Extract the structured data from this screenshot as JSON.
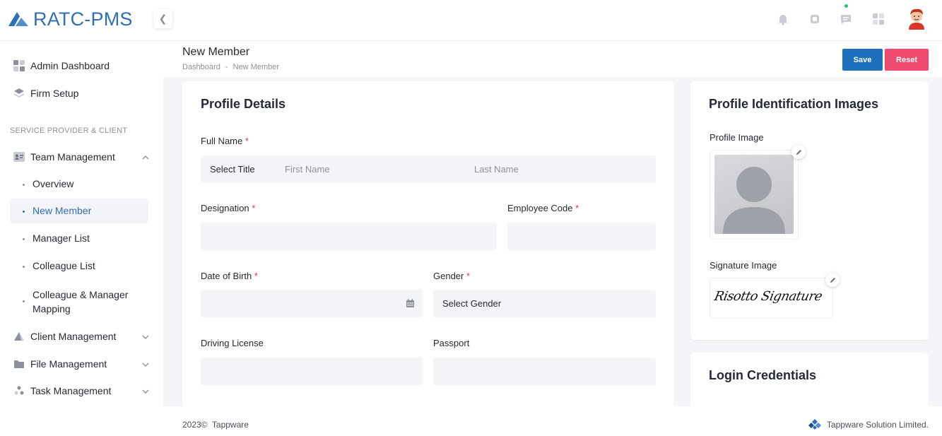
{
  "app": {
    "title": "RATC-PMS"
  },
  "colors": {
    "brand": "#2f6fb6",
    "save": "#1f6fbf",
    "reset": "#ef4a6f",
    "required": "#e5364f",
    "online": "#27c46b"
  },
  "header": {
    "collapse_icon": "chevron-left-icon",
    "icons": [
      "bell-icon",
      "square-icon",
      "chat-icon",
      "apps-grid-icon"
    ],
    "avatar": "user-avatar"
  },
  "sidebar": {
    "items": [
      {
        "label": "Admin Dashboard",
        "icon": "dashboard-grid-icon"
      },
      {
        "label": "Firm Setup",
        "icon": "layers-icon"
      }
    ],
    "section_label": "SERVICE PROVIDER & CLIENT",
    "team": {
      "label": "Team Management",
      "icon": "team-card-icon",
      "subitems": [
        "Overview",
        "New Member",
        "Manager List",
        "Colleague List",
        "Colleague & Manager Mapping"
      ]
    },
    "more": [
      {
        "label": "Client Management",
        "icon": "triangle-icon"
      },
      {
        "label": "File Management",
        "icon": "folder-icon"
      },
      {
        "label": "Task Management",
        "icon": "tasks-icon"
      }
    ]
  },
  "page": {
    "title": "New Member",
    "breadcrumb": {
      "root": "Dashboard",
      "sep": "-",
      "current": "New Member"
    },
    "save_label": "Save",
    "reset_label": "Reset"
  },
  "profile": {
    "title": "Profile Details",
    "full_name_label": "Full Name",
    "title_select": "Select Title",
    "first_name_ph": "First Name",
    "last_name_ph": "Last Name",
    "designation_label": "Designation",
    "employee_code_label": "Employee Code",
    "dob_label": "Date of Birth",
    "gender_label": "Gender",
    "gender_select": "Select Gender",
    "driving_label": "Driving License",
    "passport_label": "Passport",
    "required_mark": "*"
  },
  "identification": {
    "title": "Profile Identification Images",
    "profile_image_label": "Profile Image",
    "signature_image_label": "Signature Image",
    "signature_text": "Risotto Signature"
  },
  "login": {
    "title": "Login Credentials"
  },
  "footer": {
    "year": "2023©",
    "brand": "Tappware",
    "company": "Tappware Solution Limited."
  }
}
